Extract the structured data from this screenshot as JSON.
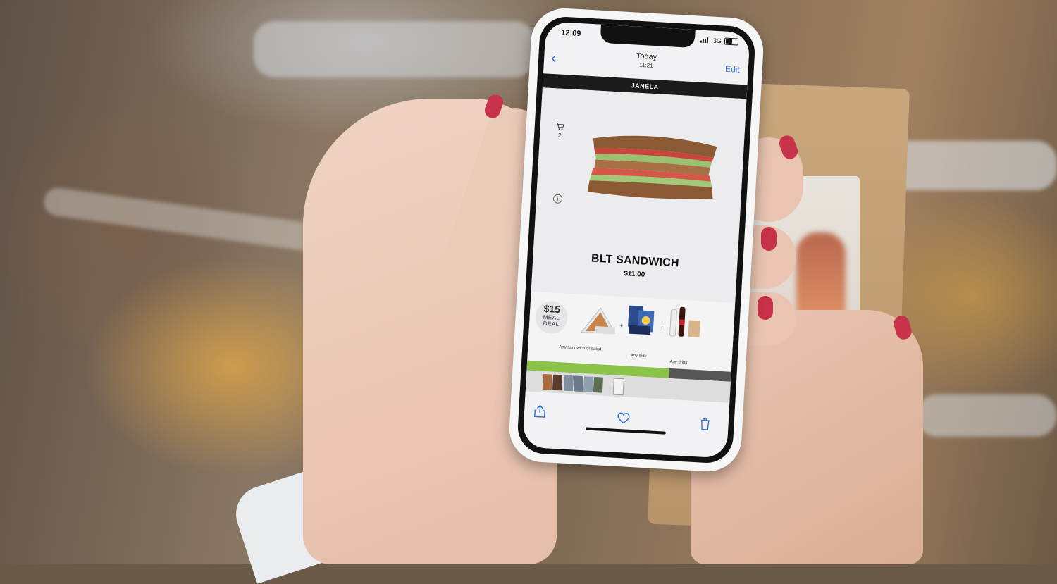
{
  "status_bar": {
    "time": "12:09",
    "network": "3G"
  },
  "nav": {
    "back_icon": "chevron-left-icon",
    "title": "Today",
    "subtitle": "11:21",
    "edit_label": "Edit"
  },
  "brand": {
    "name": "JANELA"
  },
  "product": {
    "cart_count": "2",
    "cart_icon": "cart-icon",
    "info_icon": "info-icon",
    "image": "sandwich-photo",
    "name": "BLT SANDWICH",
    "price": "$11.00"
  },
  "meal_deal": {
    "price": "$15",
    "line1": "MEAL",
    "line2": "DEAL",
    "items": [
      {
        "caption": "Any sandwich or salad"
      },
      {
        "caption": "Any side"
      },
      {
        "caption": "Any drink"
      }
    ]
  },
  "toolbar": {
    "share_icon": "share-icon",
    "favorite_icon": "heart-icon",
    "delete_icon": "trash-icon"
  },
  "colors": {
    "accent": "#2f6fd6",
    "brand_bar": "#1b1b1b",
    "progress": "#8bc34a"
  }
}
